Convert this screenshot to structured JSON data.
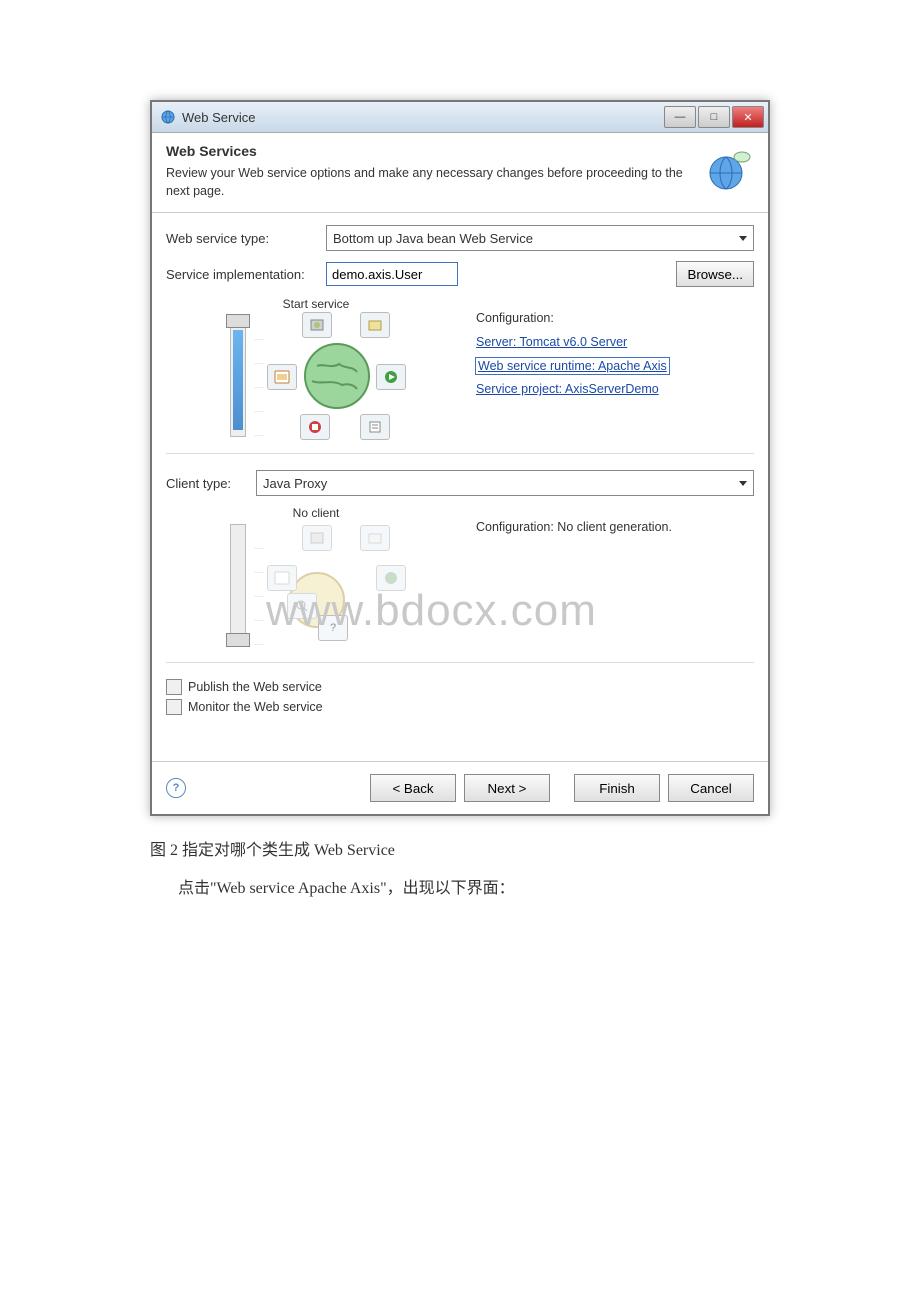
{
  "window": {
    "title": "Web Service"
  },
  "banner": {
    "title": "Web Services",
    "description": "Review your Web service options and make any necessary changes before proceeding to the next page."
  },
  "fields": {
    "service_type_label": "Web service type:",
    "service_type_value": "Bottom up Java bean Web Service",
    "service_impl_label": "Service implementation:",
    "service_impl_value": "demo.axis.User",
    "browse_label": "Browse...",
    "client_type_label": "Client type:",
    "client_type_value": "Java Proxy"
  },
  "service_panel": {
    "slider_label": "Start service",
    "config_heading": "Configuration:",
    "server_link": "Server: Tomcat v6.0 Server",
    "runtime_link": "Web service runtime: Apache Axis",
    "project_link": "Service project: AxisServerDemo"
  },
  "client_panel": {
    "slider_label": "No client",
    "config_text": "Configuration: No client generation."
  },
  "checkboxes": {
    "publish": "Publish the Web service",
    "monitor": "Monitor the Web service"
  },
  "buttons": {
    "back": "< Back",
    "next": "Next >",
    "finish": "Finish",
    "cancel": "Cancel"
  },
  "watermark": "www.bdocx.com",
  "caption": "图 2 指定对哪个类生成 Web Service",
  "paragraph": "点击\"Web service Apache Axis\"，出现以下界面："
}
